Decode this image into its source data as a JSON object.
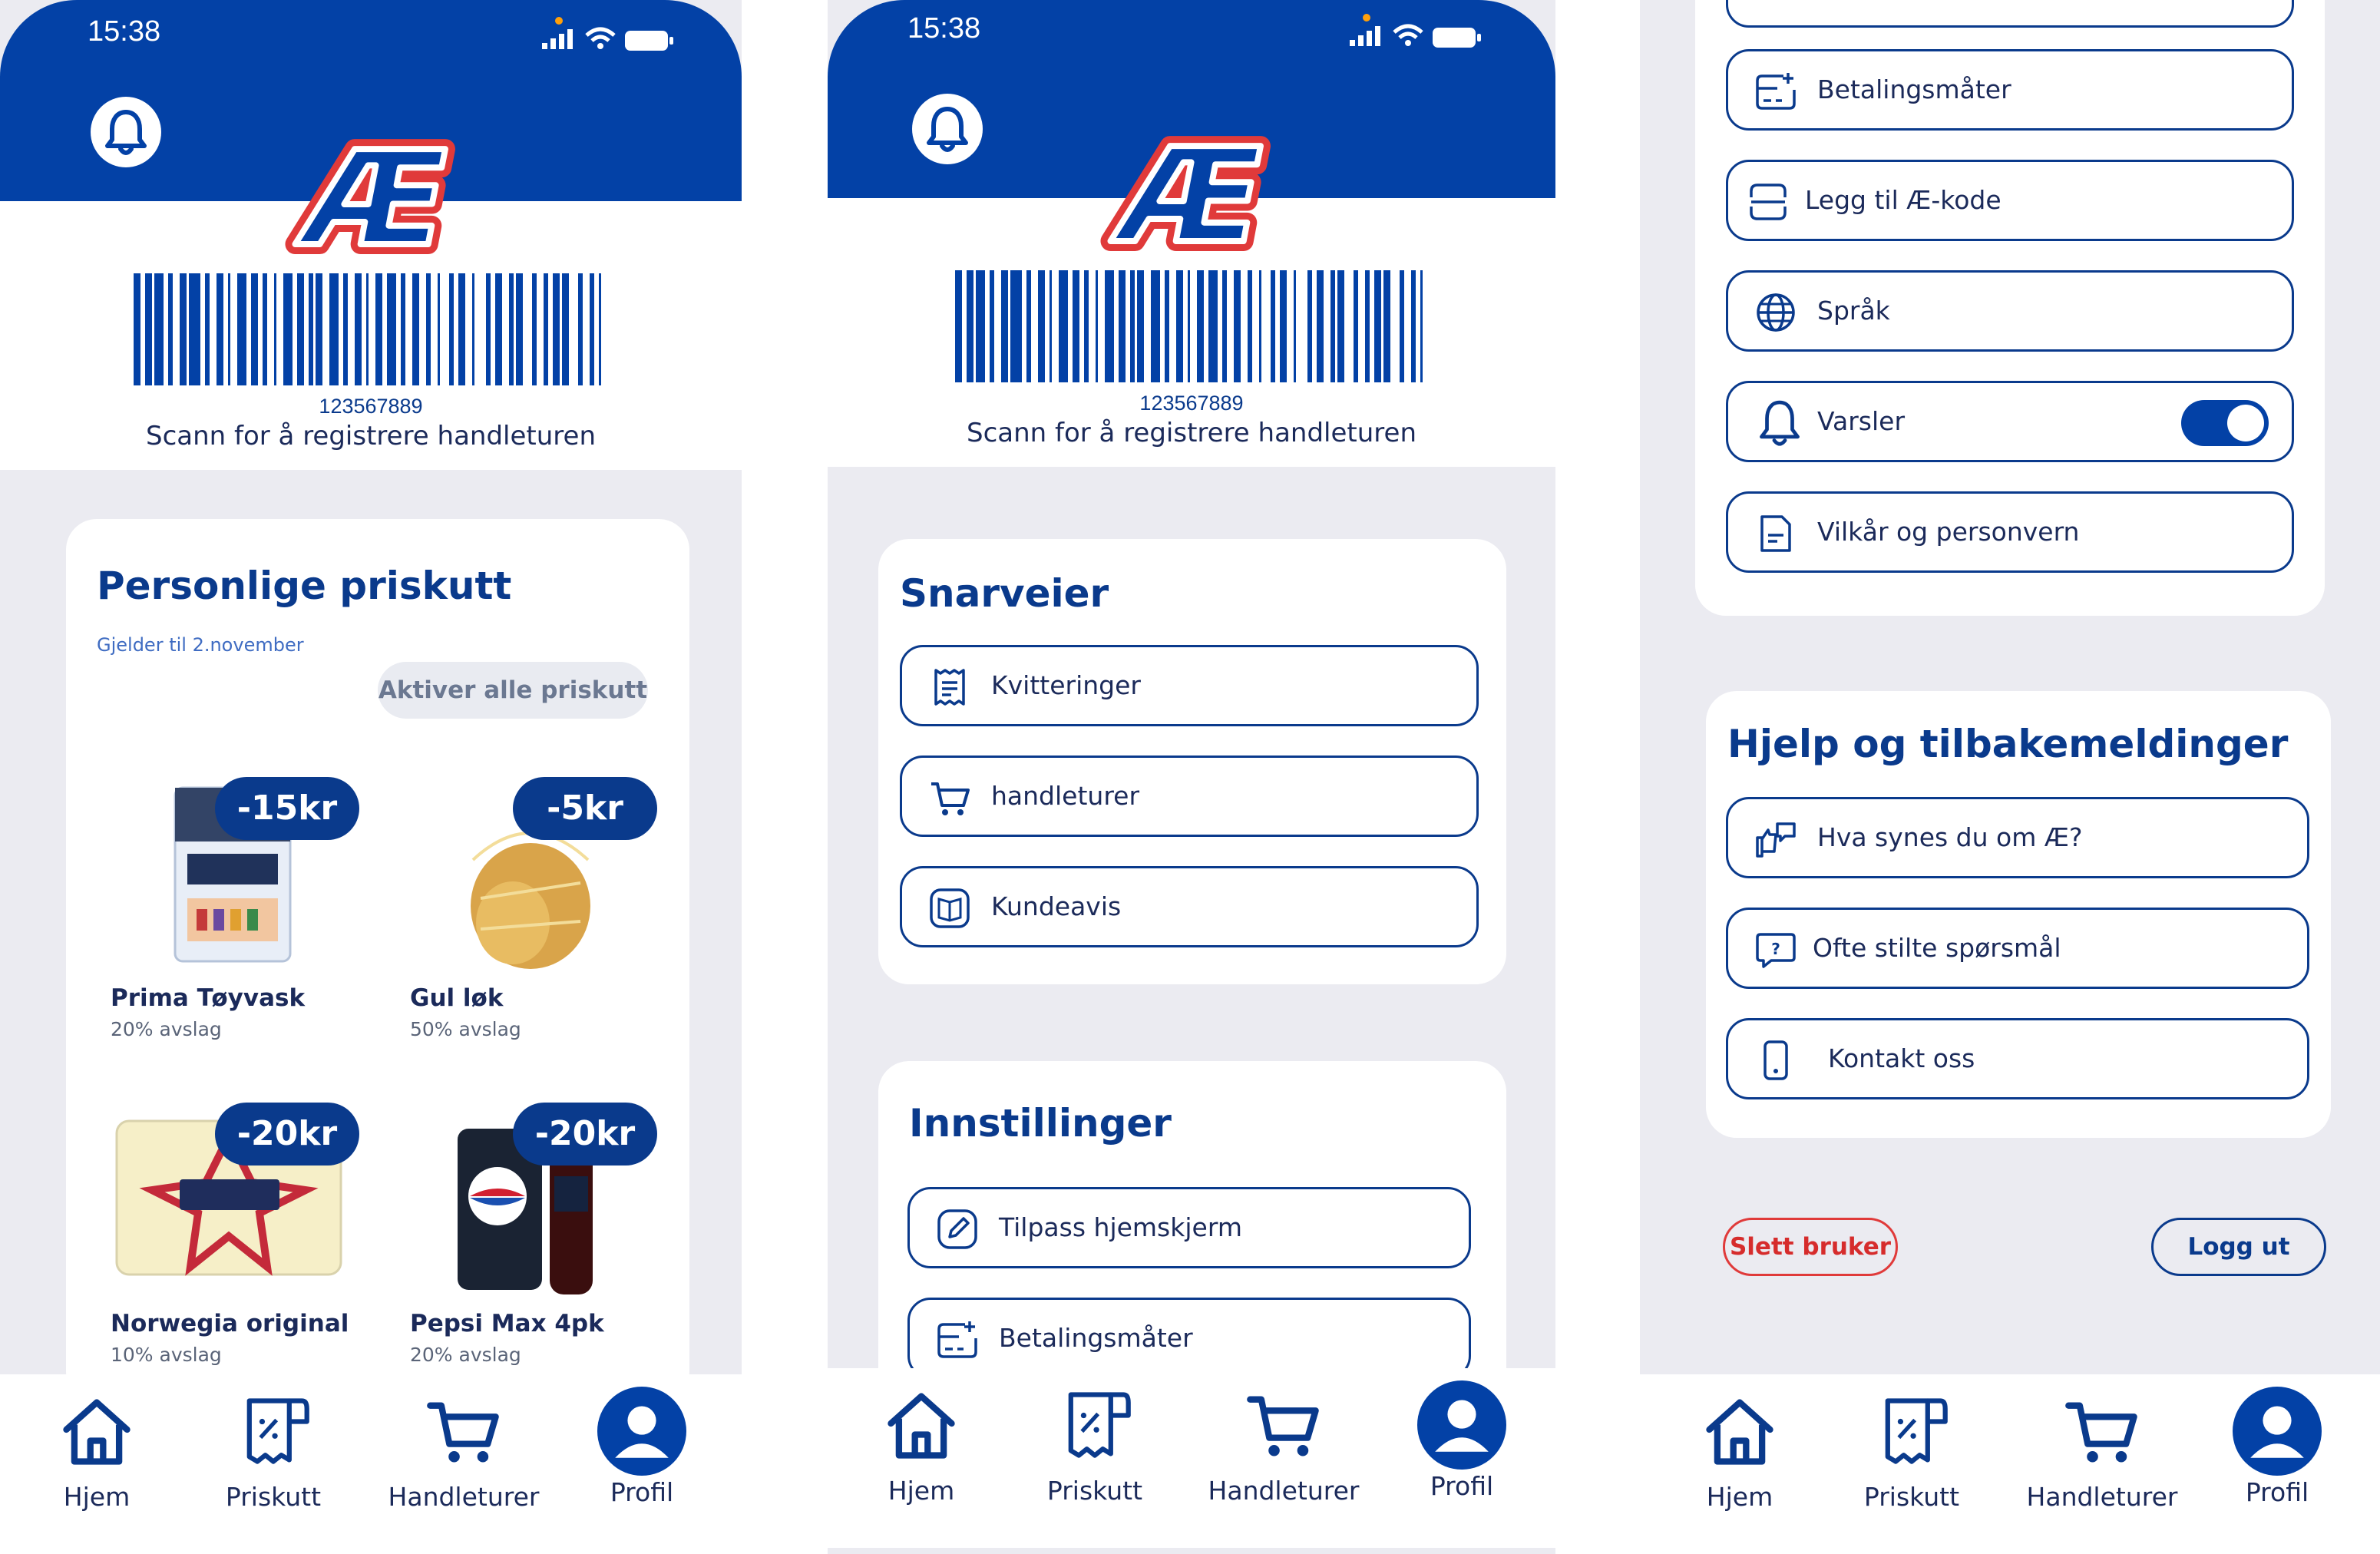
{
  "colors": {
    "brand_blue": "#0341a6",
    "dark_blue": "#0a3a8c",
    "background": "#ebebf1",
    "danger": "#d62c2c"
  },
  "status_bar": {
    "time": "15:38"
  },
  "barcode": {
    "number": "123567889",
    "caption": "Scann for å registrere handleturen"
  },
  "logo_text": "Æ",
  "screen_home": {
    "title": "Personlige priskutt",
    "valid_until": "Gjelder til 2.november",
    "activate_all": "Aktiver alle priskutt",
    "products": [
      {
        "name": "Prima Tøyvask",
        "discount": "20% avslag",
        "badge": "-15kr",
        "icon": "detergent-box"
      },
      {
        "name": "Gul løk",
        "discount": "50% avslag",
        "badge": "-5kr",
        "icon": "onion-net"
      },
      {
        "name": "Norwegia original",
        "discount": "10% avslag",
        "badge": "-20kr",
        "icon": "cheese-block"
      },
      {
        "name": "Pepsi Max 4pk",
        "discount": "20% avslag",
        "badge": "-20kr",
        "icon": "soda-bottles"
      }
    ]
  },
  "screen_profile": {
    "shortcuts_title": "Snarveier",
    "shortcuts": [
      {
        "label": "Kvitteringer",
        "icon": "receipt-icon"
      },
      {
        "label": "handleturer",
        "icon": "cart-icon"
      },
      {
        "label": "Kundeavis",
        "icon": "book-icon"
      }
    ],
    "settings_title": "Innstillinger",
    "settings": [
      {
        "label": "Tilpass hjemskjerm",
        "icon": "edit-icon"
      },
      {
        "label": "Betalingsmåter",
        "icon": "card-icon"
      }
    ]
  },
  "screen_profile_scrolled": {
    "settings": [
      {
        "label": "Betalingsmåter",
        "icon": "card-icon"
      },
      {
        "label": "Legg til Æ-kode",
        "icon": "code-icon"
      },
      {
        "label": "Språk",
        "icon": "globe-icon"
      },
      {
        "label": "Varsler",
        "icon": "bell-icon",
        "toggle_on": true
      },
      {
        "label": "Vilkår og personvern",
        "icon": "document-icon"
      }
    ],
    "help_title": "Hjelp og tilbakemeldinger",
    "help": [
      {
        "label": "Hva synes du om Æ?",
        "icon": "feedback-icon"
      },
      {
        "label": "Ofte stilte spørsmål",
        "icon": "question-icon"
      },
      {
        "label": "Kontakt oss",
        "icon": "phone-icon"
      }
    ],
    "delete_user": "Slett bruker",
    "logout": "Logg ut"
  },
  "nav": [
    {
      "label": "Hjem",
      "icon": "home-icon"
    },
    {
      "label": "Priskutt",
      "icon": "coupon-icon"
    },
    {
      "label": "Handleturer",
      "icon": "cart-icon"
    },
    {
      "label": "Profil",
      "icon": "profile-icon"
    }
  ]
}
